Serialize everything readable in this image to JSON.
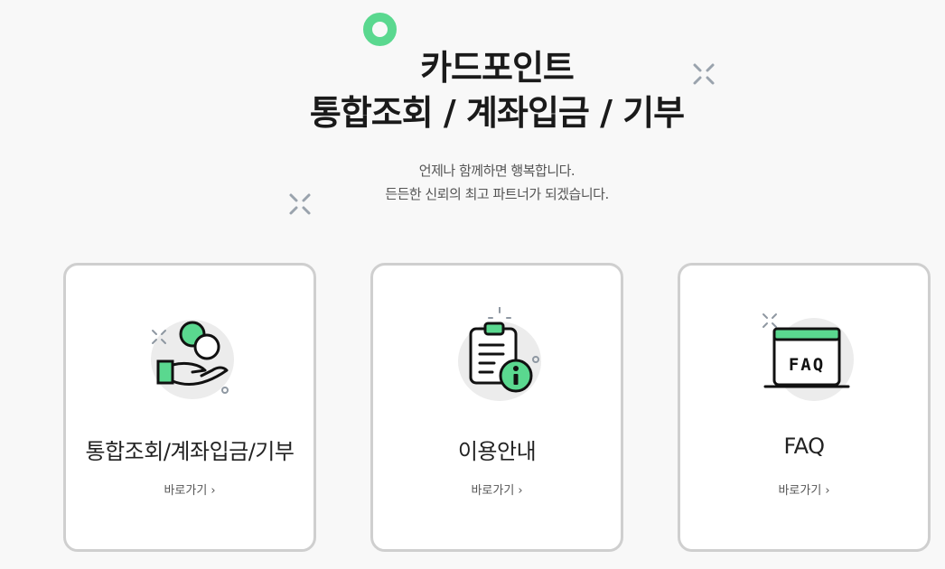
{
  "header": {
    "title_line1": "카드포인트",
    "title_line2": "통합조회 / 계좌입금 / 기부",
    "subtitle_line1": "언제나 함께하면 행복합니다.",
    "subtitle_line2": "든든한 신뢰의 최고 파트너가 되겠습니다."
  },
  "colors": {
    "accent": "#5ad88f",
    "card_border": "#cfcfcf",
    "background": "#f8f8f8"
  },
  "cards": [
    {
      "label": "통합조회/계좌입금/기부",
      "link": "바로가기",
      "icon": "coin-hand-icon"
    },
    {
      "label": "이용안내",
      "link": "바로가기",
      "icon": "clipboard-info-icon"
    },
    {
      "label": "FAQ",
      "link": "바로가기",
      "icon": "faq-window-icon",
      "icon_text": "FAQ"
    }
  ],
  "link_chevron": "›"
}
